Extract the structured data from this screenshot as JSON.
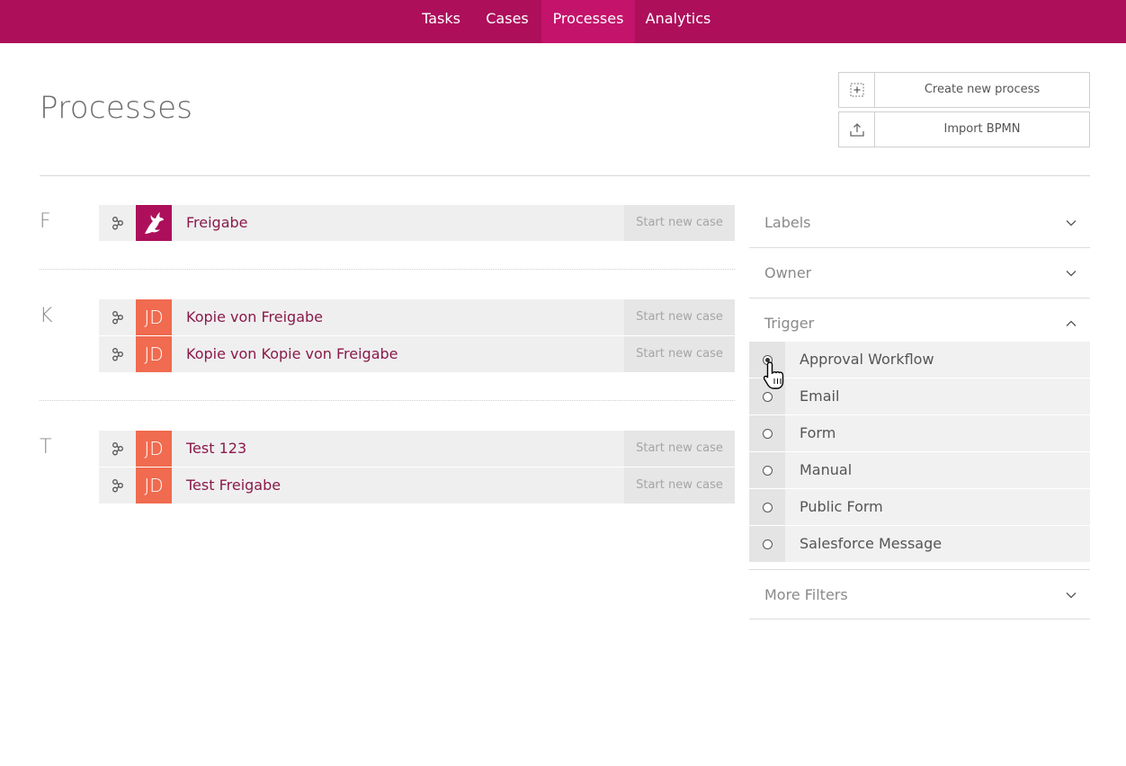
{
  "nav": {
    "tabs": [
      {
        "label": "Tasks",
        "active": false
      },
      {
        "label": "Cases",
        "active": false
      },
      {
        "label": "Processes",
        "active": true
      },
      {
        "label": "Analytics",
        "active": false
      }
    ],
    "brand_color": "#ad0f5b",
    "active_color": "#c4136b"
  },
  "page": {
    "title": "Processes"
  },
  "actions": {
    "create_label": "Create new process",
    "create_icon": "add-box-icon",
    "import_label": "Import BPMN",
    "import_icon": "upload-icon"
  },
  "groups": [
    {
      "letter": "F",
      "processes": [
        {
          "name": "Freigabe",
          "avatar": "logo",
          "start_label": "Start new case"
        }
      ]
    },
    {
      "letter": "K",
      "processes": [
        {
          "name": "Kopie von Freigabe",
          "avatar": "JD",
          "start_label": "Start new case"
        },
        {
          "name": "Kopie von Kopie von Freigabe",
          "avatar": "JD",
          "start_label": "Start new case"
        }
      ]
    },
    {
      "letter": "T",
      "processes": [
        {
          "name": "Test 123",
          "avatar": "JD",
          "start_label": "Start new case"
        },
        {
          "name": "Test Freigabe",
          "avatar": "JD",
          "start_label": "Start new case"
        }
      ]
    }
  ],
  "filters": {
    "labels": "Labels",
    "owner": "Owner",
    "trigger": "Trigger",
    "more": "More Filters",
    "trigger_options": [
      {
        "label": "Approval Workflow",
        "selected": true
      },
      {
        "label": "Email",
        "selected": false
      },
      {
        "label": "Form",
        "selected": false
      },
      {
        "label": "Manual",
        "selected": false
      },
      {
        "label": "Public Form",
        "selected": false
      },
      {
        "label": "Salesforce Message",
        "selected": false
      }
    ]
  },
  "colors": {
    "avatar_jd": "#f06b4f",
    "process_name": "#8a1a4a"
  }
}
